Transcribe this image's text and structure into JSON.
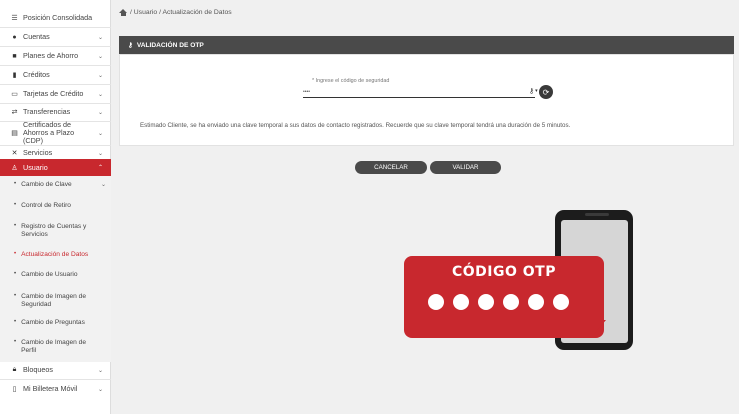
{
  "breadcrumb": {
    "text": "/ Usuario / Actualización de Datos"
  },
  "sidebar": {
    "items": [
      {
        "label": "Posición Consolidada",
        "icon": "list-icon"
      },
      {
        "label": "Cuentas",
        "icon": "circle-icon"
      },
      {
        "label": "Planes de Ahorro",
        "icon": "piggy-bank-icon"
      },
      {
        "label": "Créditos",
        "icon": "building-icon"
      },
      {
        "label": "Tarjetas de Crédito",
        "icon": "card-icon"
      },
      {
        "label": "Transferencias",
        "icon": "transfer-icon"
      },
      {
        "label": "Certificados de Ahorros a Plazo (CDP)",
        "icon": "certificate-icon"
      },
      {
        "label": "Servicios",
        "icon": "tools-icon"
      },
      {
        "label": "Usuario",
        "icon": "user-icon"
      },
      {
        "label": "Bloqueos",
        "icon": "lock-icon"
      },
      {
        "label": "Mi Billetera Móvil",
        "icon": "phone-icon"
      }
    ],
    "sub_items": [
      {
        "label": "Cambio de Clave"
      },
      {
        "label": "Control de Retiro"
      },
      {
        "label": "Registro de Cuentas y Servicios"
      },
      {
        "label": "Actualización de Datos"
      },
      {
        "label": "Cambio de Usuario"
      },
      {
        "label": "Cambio de Imagen de Seguridad"
      },
      {
        "label": "Cambio de Preguntas"
      },
      {
        "label": "Cambio de Imagen de Perfil"
      }
    ]
  },
  "panel": {
    "title": "VALIDACIÓN DE OTP",
    "otp_label": "* Ingrese el código de seguridad",
    "otp_value": "••••",
    "info": "Estimado Cliente, se ha enviado una clave temporal a sus datos de contacto registrados. Recuerde que su clave temporal tendrá una duración de 5 minutos."
  },
  "buttons": {
    "cancel": "CANCELAR",
    "validate": "VALIDAR"
  },
  "illustration": {
    "title": "CÓDIGO OTP"
  },
  "colors": {
    "accent": "#c8282e",
    "header": "#4a4a4a"
  }
}
